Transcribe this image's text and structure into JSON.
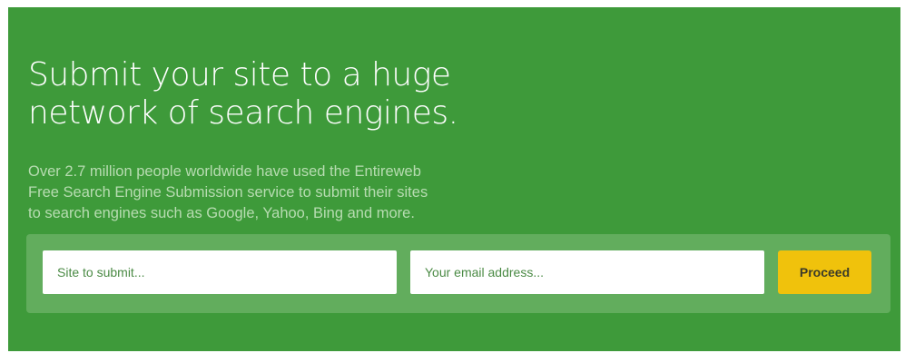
{
  "hero": {
    "headline_line1": "Submit your site to a huge",
    "headline_line2": "network of search engines.",
    "description_line1": "Over 2.7 million people worldwide have used the Entireweb",
    "description_line2": "Free Search Engine Submission service to submit their sites",
    "description_line3": "to search engines such as Google, Yahoo, Bing and more."
  },
  "form": {
    "site_placeholder": "Site to submit...",
    "email_placeholder": "Your email address...",
    "proceed_label": "Proceed"
  },
  "colors": {
    "background": "#3e9a3a",
    "panel": "#62ad5d",
    "button": "#f0c20c"
  }
}
